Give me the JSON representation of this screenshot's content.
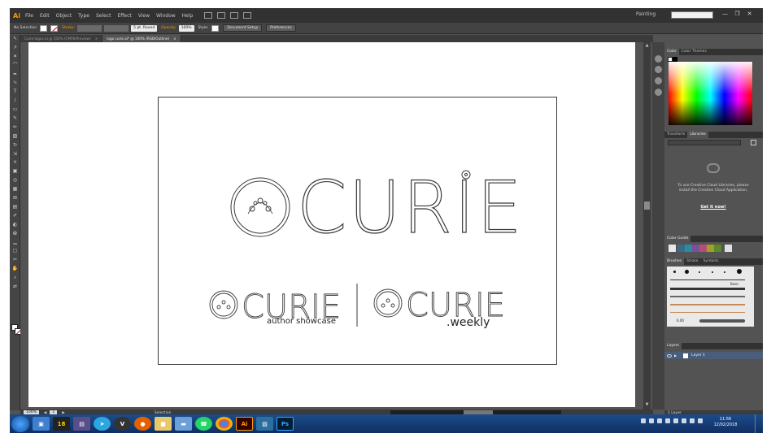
{
  "menubar": {
    "app_logo": "Ai",
    "items": [
      "File",
      "Edit",
      "Object",
      "Type",
      "Select",
      "Effect",
      "View",
      "Window",
      "Help"
    ],
    "workspace": "Painting",
    "window_controls": [
      "—",
      "❐",
      "✕"
    ]
  },
  "control_bar": {
    "selection_label": "No Selection",
    "stroke_label": "Stroke:",
    "brush_label": "5 pt. Round",
    "opacity_label": "Opacity:",
    "opacity_value": "100%",
    "style_label": "Style:",
    "document_setup": "Document Setup",
    "preferences": "Preferences"
  },
  "tabs": [
    {
      "label": "Curie-logos.ai @ 150% (CMYK/Preview)",
      "close": "×"
    },
    {
      "label": "logo curie.ai* @ 100% (RGB/Outline)",
      "close": "×"
    }
  ],
  "artwork": {
    "main_wordmark": "CURIE",
    "sub_wordmark_1": "CURIE",
    "sub_caption_1": "author showcase",
    "sub_wordmark_2": "CURIE",
    "sub_caption_2": ".weekly"
  },
  "status_bar": {
    "zoom": "100%",
    "page": "1",
    "tool": "Selection"
  },
  "panels": {
    "color_tabs": [
      "Color",
      "Color Themes"
    ],
    "libraries_tabs": [
      "Transform",
      "Libraries"
    ],
    "libraries_message": "To use Creative Cloud Libraries, please install the Creative Cloud Application.",
    "libraries_link": "Get it now!",
    "color_guide_tab": "Color Guide",
    "brush_tabs": [
      "Brushes",
      "Stroke",
      "Symbols"
    ],
    "brush_basic": "Basic",
    "brush_size": "6.00",
    "layers_tab": "Layers",
    "layer_name": "Layer 1",
    "layers_footer": "1 Layer",
    "colors": {
      "accent": "#ff9a00",
      "layer_selected": "#4a5d7a"
    }
  },
  "taskbar": {
    "pinned": [
      "explorer",
      "18",
      "archive",
      "telegram",
      "vivaldi",
      "firefox",
      "folder",
      "messenger",
      "whatsapp",
      "chrome",
      "illustrator",
      "photoshop-alt",
      "photoshop"
    ],
    "ai_label": "Ai",
    "ps_label": "Ps",
    "num_label": "18",
    "time": "11:56",
    "date": "12/02/2018"
  }
}
